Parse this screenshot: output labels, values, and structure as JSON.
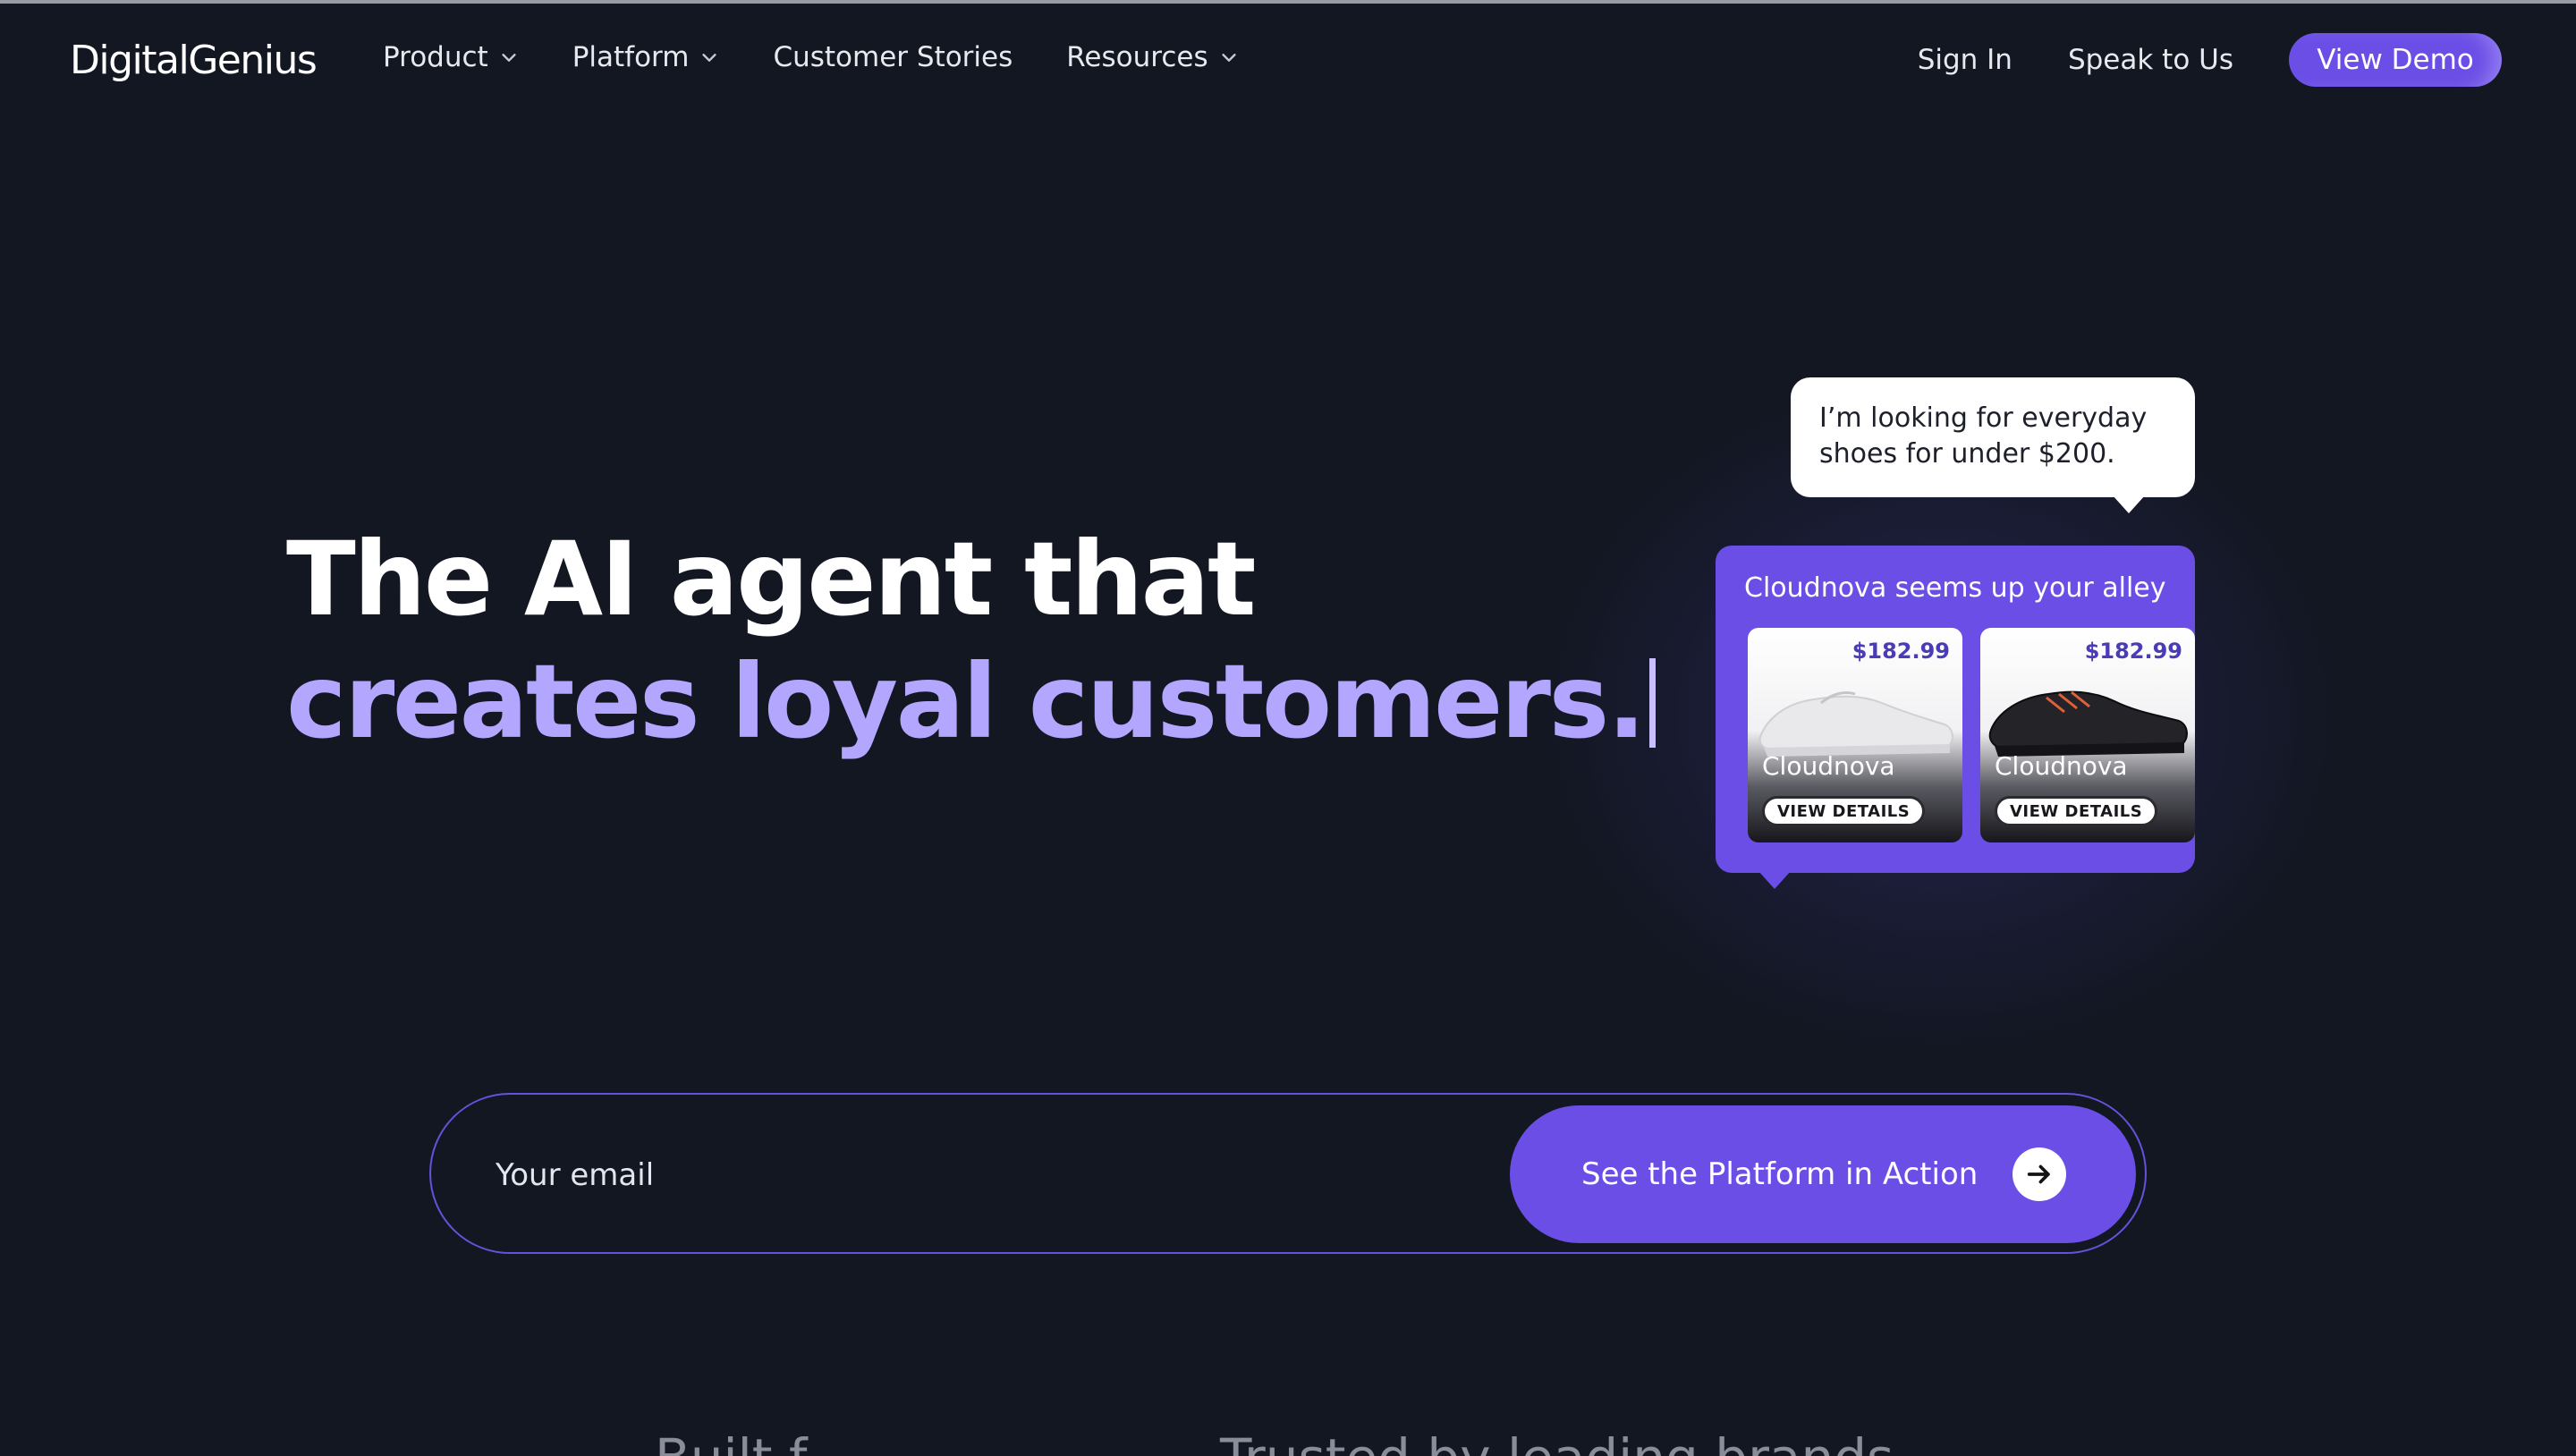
{
  "header": {
    "logo": "DigitalGenius",
    "nav": [
      {
        "label": "Product",
        "icon": "chevron-down-icon"
      },
      {
        "label": "Platform",
        "icon": "chevron-down-icon"
      },
      {
        "label": "Customer Stories"
      },
      {
        "label": "Resources",
        "icon": "chevron-down-icon"
      }
    ],
    "sign_in": "Sign In",
    "speak": "Speak to Us",
    "demo": "View Demo"
  },
  "hero": {
    "line1": "The AI agent that",
    "line2": "creates loyal customers."
  },
  "chat": {
    "user_message": "I’m looking for everyday shoes for under $200.",
    "bot_message": "Cloudnova seems up your alley",
    "products": [
      {
        "price": "$182.99",
        "name": "Cloudnova",
        "button": "VIEW DETAILS",
        "shoe_color": "white"
      },
      {
        "price": "$182.99",
        "name": "Cloudnova",
        "button": "VIEW DETAILS",
        "shoe_color": "black"
      }
    ]
  },
  "form": {
    "email_placeholder": "Your email",
    "cta": "See the Platform in Action",
    "cta_icon": "arrow-right-icon"
  },
  "below_fold": {
    "left_text": "Built f",
    "right_text": "Trusted by leading brands"
  },
  "colors": {
    "background": "#121722",
    "accent": "#6b4ee6",
    "hero_highlight": "#b3a6ff"
  }
}
